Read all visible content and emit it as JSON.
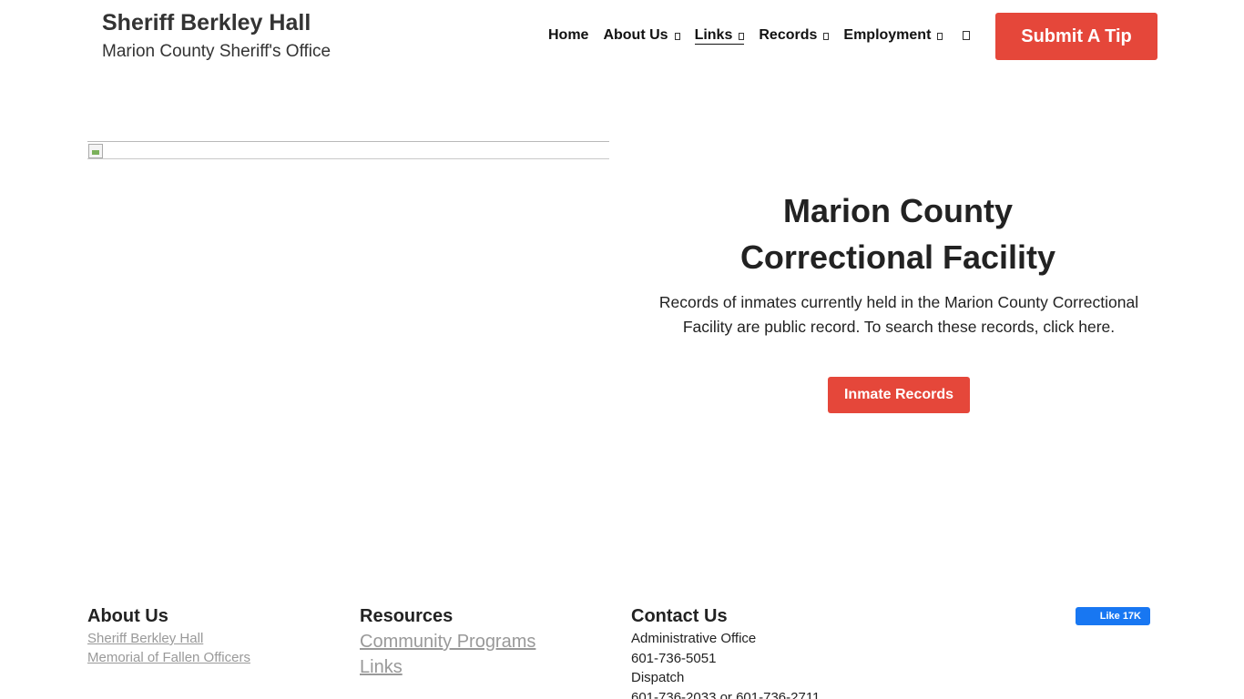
{
  "header": {
    "title": "Sheriff Berkley Hall",
    "subtitle": "Marion County Sheriff's Office"
  },
  "nav": {
    "items": [
      {
        "label": "Home"
      },
      {
        "label": "About Us"
      },
      {
        "label": "Links"
      },
      {
        "label": "Records"
      },
      {
        "label": "Employment"
      }
    ],
    "cta": "Submit A Tip"
  },
  "main": {
    "title_line1": "Marion County",
    "title_line2": "Correctional Facility",
    "description": "Records of inmates currently held in the Marion County Correctional Facility are public record. To search these records, click here.",
    "button": "Inmate Records"
  },
  "footer": {
    "about": {
      "heading": "About Us",
      "links": [
        "Sheriff Berkley Hall",
        "Memorial of Fallen Officers"
      ]
    },
    "resources": {
      "heading": "Resources",
      "links": [
        "Community Programs",
        "Links"
      ]
    },
    "contact": {
      "heading": "Contact Us",
      "lines": [
        "Administrative Office",
        "601-736-5051",
        "Dispatch",
        "601-736-2033 or 601-736-2711"
      ]
    },
    "facebook": {
      "label": "Like 17K"
    }
  },
  "colors": {
    "accent": "#e5473a",
    "facebook": "#1877f2",
    "link_muted": "#999999"
  }
}
